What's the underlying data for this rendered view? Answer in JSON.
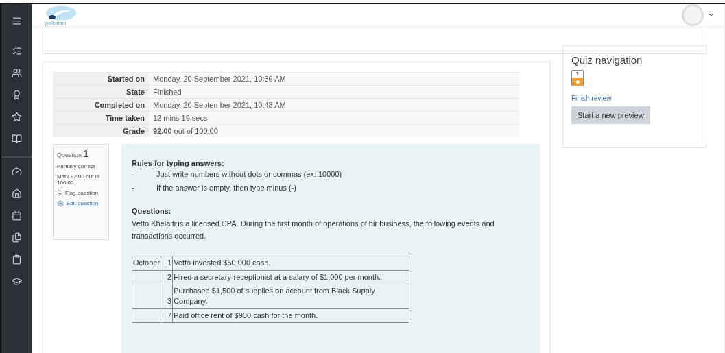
{
  "header": {
    "logo_text": "polibatam"
  },
  "summary": [
    {
      "label": "Started on",
      "value": "Monday, 20 September 2021, 10:36 AM"
    },
    {
      "label": "State",
      "value": "Finished"
    },
    {
      "label": "Completed on",
      "value": "Monday, 20 September 2021, 10:48 AM"
    },
    {
      "label": "Time taken",
      "value": "12 mins 19 secs"
    },
    {
      "label": "Grade",
      "value": "**92.00** out of 100.00"
    }
  ],
  "question_info": {
    "title": "Question",
    "number": "1",
    "state": "Partially correct",
    "mark": "Mark 92.00 out of 100.00",
    "flag": "Flag question",
    "edit": "Edit question"
  },
  "question": {
    "rules_title": "Rules for typing answers:",
    "rules": [
      {
        "bullet": "-",
        "text": "Just write numbers without dots or commas (ex: 10000)"
      },
      {
        "bullet": "-",
        "text": "If the answer is empty, then type minus (-)"
      }
    ],
    "questions_title": "Questions:",
    "intro": "Vetto Khelaifi is a licensed CPA. During the first month of operations of hir business, the following events and transactions occurred.",
    "transactions": [
      {
        "month": "October",
        "day": "1",
        "text": "Vetto invested $50,000 cash."
      },
      {
        "day": "2",
        "text": "Hired a secretary-receptionist at a salary of $1,000 per month."
      },
      {
        "day": "3",
        "text": "Purchased $1,500 of supplies on account from Black Supply Company."
      },
      {
        "day": "7",
        "text": "Paid office rent of $900 cash for the month."
      }
    ]
  },
  "quiz_navigation": {
    "title": "Quiz navigation",
    "questions": [
      {
        "label": "1",
        "color": "#f0a030"
      }
    ],
    "finish_link": "Finish review",
    "preview_button": "Start a new preview"
  }
}
